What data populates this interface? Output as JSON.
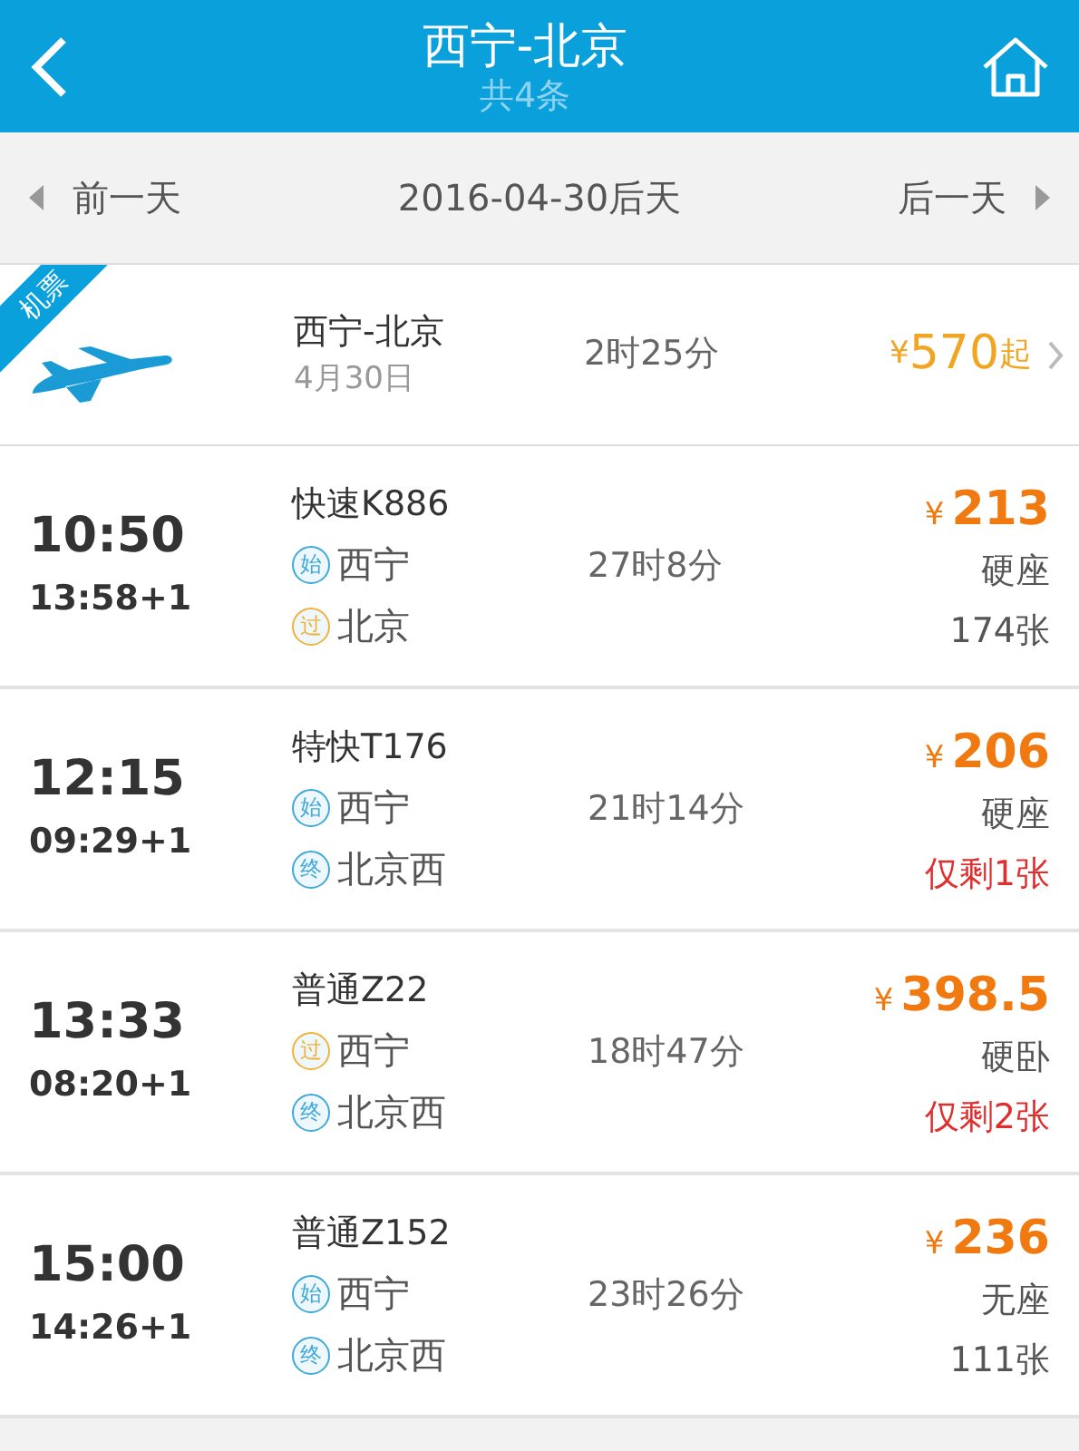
{
  "header": {
    "title": "西宁-北京",
    "subtitle": "共4条"
  },
  "date_bar": {
    "prev": "前一天",
    "date": "2016-04-30后天",
    "next": "后一天"
  },
  "flight": {
    "tag": "机票",
    "route": "西宁-北京",
    "date": "4月30日",
    "duration": "2时25分",
    "currency": "¥",
    "price": "570",
    "suffix": "起"
  },
  "trains": [
    {
      "depart": "10:50",
      "arrive": "13:58+1",
      "name": "快速K886",
      "duration": "27时8分",
      "currency": "¥",
      "price": "213",
      "seat": "硬座",
      "remaining": "174张",
      "scarce": false,
      "stations": [
        {
          "badge": "始",
          "name": "西宁",
          "color": "#3fa9d8"
        },
        {
          "badge": "过",
          "name": "北京",
          "color": "#f0b23c"
        }
      ]
    },
    {
      "depart": "12:15",
      "arrive": "09:29+1",
      "name": "特快T176",
      "duration": "21时14分",
      "currency": "¥",
      "price": "206",
      "seat": "硬座",
      "remaining": "仅剩1张",
      "scarce": true,
      "stations": [
        {
          "badge": "始",
          "name": "西宁",
          "color": "#3fa9d8"
        },
        {
          "badge": "终",
          "name": "北京西",
          "color": "#3fa9d8"
        }
      ]
    },
    {
      "depart": "13:33",
      "arrive": "08:20+1",
      "name": "普通Z22",
      "duration": "18时47分",
      "currency": "¥",
      "price": "398.5",
      "seat": "硬卧",
      "remaining": "仅剩2张",
      "scarce": true,
      "stations": [
        {
          "badge": "过",
          "name": "西宁",
          "color": "#f0b23c"
        },
        {
          "badge": "终",
          "name": "北京西",
          "color": "#3fa9d8"
        }
      ]
    },
    {
      "depart": "15:00",
      "arrive": "14:26+1",
      "name": "普通Z152",
      "duration": "23时26分",
      "currency": "¥",
      "price": "236",
      "seat": "无座",
      "remaining": "111张",
      "scarce": false,
      "stations": [
        {
          "badge": "始",
          "name": "西宁",
          "color": "#3fa9d8"
        },
        {
          "badge": "终",
          "name": "北京西",
          "color": "#3fa9d8"
        }
      ]
    }
  ]
}
